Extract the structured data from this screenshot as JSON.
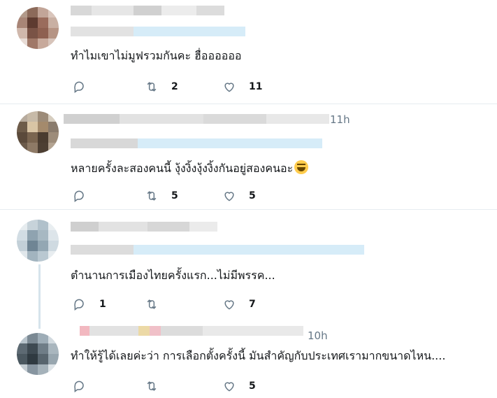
{
  "tweets": [
    {
      "text": "ทำไมเขาไม่มูฟรวมกันคะ ฮื่ออออออ",
      "time": "",
      "reply_count": "",
      "retweet_count": "2",
      "like_count": "11"
    },
    {
      "text": "หลายครั้งละสองคนนี้ งุ้งงิ้งงุ้งงิ้งกันอยู่สองคนอะ",
      "time": "11h",
      "reply_count": "",
      "retweet_count": "5",
      "like_count": "5",
      "emoji": "grinning-squinting-face"
    },
    {
      "text": "ตำนานการเมืองไทยครั้งแรก...ไม่มีพรรค...",
      "time": "",
      "reply_count": "1",
      "retweet_count": "",
      "like_count": "7"
    },
    {
      "text": "ทำให้รู้ได้เลยค่ะว่า การเลือกตั้งครั้งนี้ มันสำคัญกับประเทศเรามากขนาดไหน....",
      "time": "10h",
      "reply_count": "",
      "retweet_count": "",
      "like_count": "5"
    }
  ],
  "icons": {
    "reply": "reply-icon",
    "retweet": "retweet-icon",
    "like": "heart-icon"
  },
  "colors": {
    "icon": "#657786",
    "divider": "#e6ecf0",
    "thread_line": "#ccd6dd"
  }
}
